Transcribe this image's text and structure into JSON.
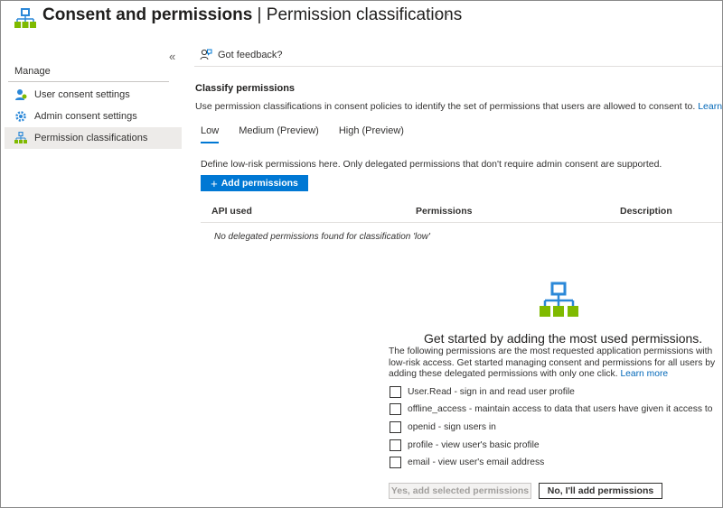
{
  "header": {
    "title": "Consent and permissions",
    "separator": " | ",
    "subtitle": "Permission classifications",
    "more": "···",
    "icon": "org-hierarchy-icon"
  },
  "sidebar": {
    "collapse": "«",
    "section_label": "Manage",
    "items": [
      {
        "label": "User consent settings",
        "icon": "user-consent-icon"
      },
      {
        "label": "Admin consent settings",
        "icon": "gear-icon"
      },
      {
        "label": "Permission classifications",
        "icon": "org-hierarchy-icon",
        "active": true
      }
    ]
  },
  "toolbar": {
    "feedback_label": "Got feedback?",
    "feedback_icon": "feedback-icon"
  },
  "content": {
    "section_title": "Classify permissions",
    "section_desc": "Use permission classifications in consent policies to identify the set of permissions that users are allowed to consent to.",
    "learn_more": "Learn more",
    "tabs": [
      "Low",
      "Medium (Preview)",
      "High (Preview)"
    ],
    "active_tab": "Low",
    "define_text": "Define low-risk permissions here. Only delegated permissions that don't require admin consent are supported.",
    "add_button": "Add permissions",
    "table": {
      "columns": [
        "API used",
        "Permissions",
        "Description"
      ],
      "empty_text": "No delegated permissions found for classification 'low'"
    }
  },
  "getting_started": {
    "title": "Get started by adding the most used permissions.",
    "desc": "The following permissions are the most requested application permissions with low-risk access. Get started managing consent and permissions for all users by adding these delegated permissions with only one click.",
    "learn_more": "Learn more",
    "permissions": [
      "User.Read - sign in and read user profile",
      "offline_access - maintain access to data that users have given it access to",
      "openid - sign users in",
      "profile - view user's basic profile",
      "email - view user's email address"
    ],
    "primary_button": "Yes, add selected permissions",
    "secondary_button": "No, I'll add permissions"
  },
  "colors": {
    "accent": "#0078d4",
    "link": "#0067b8",
    "icon_blue": "#2b88d8",
    "icon_green": "#7fba00"
  }
}
